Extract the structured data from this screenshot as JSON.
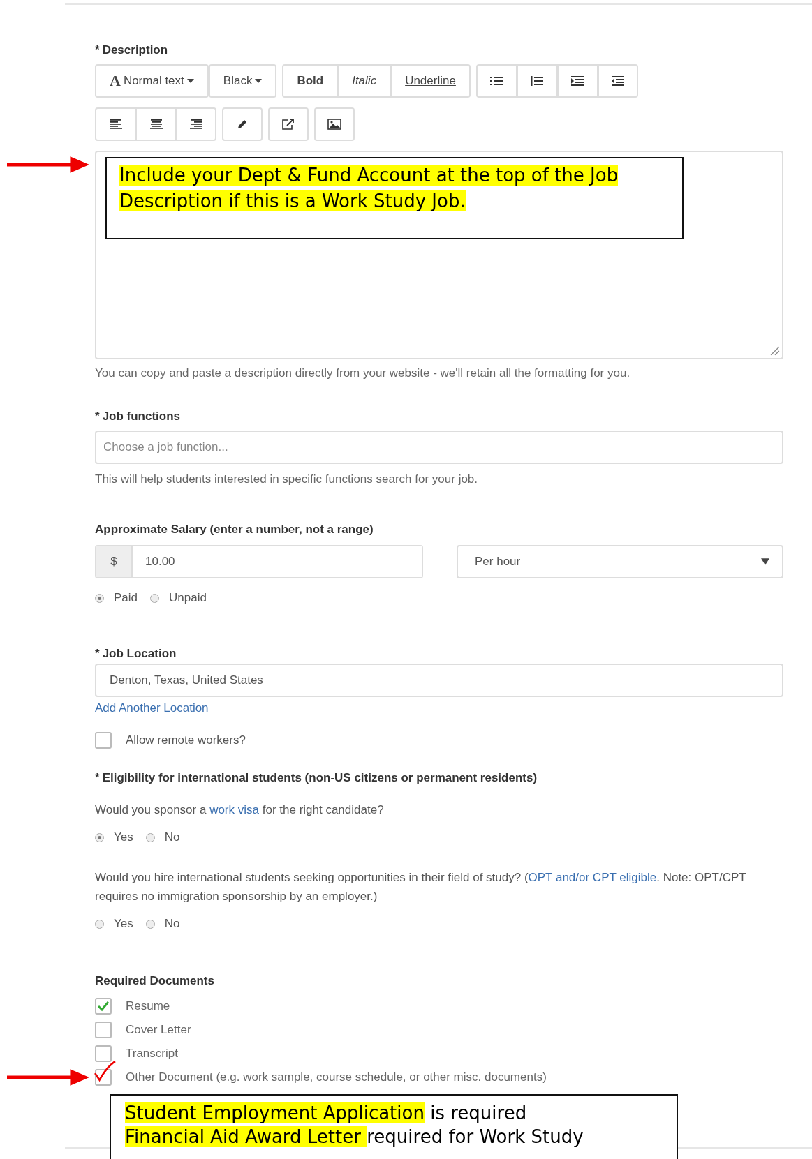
{
  "description": {
    "label": "Description",
    "marker": "*",
    "toolbar": [
      {
        "label": "Normal text",
        "prefix": "A",
        "kind": "dropdown"
      },
      {
        "label": "Black",
        "kind": "dropdown"
      },
      {
        "label": "Bold",
        "kind": "bold"
      },
      {
        "label": "Italic",
        "kind": "italic"
      },
      {
        "label": "Underline",
        "kind": "underline"
      }
    ],
    "note": "Include your Dept & Fund Account at the top of the Job Description if this is a Work Study Job.",
    "help": "You can copy and paste a description directly from your website - we'll retain all the formatting for you."
  },
  "job_functions": {
    "label": "Job functions",
    "marker": "*",
    "placeholder": "Choose a job function...",
    "help": "This will help students interested in specific functions search for your job."
  },
  "salary": {
    "label": "Approximate Salary (enter a number, not a range)",
    "currency": "$",
    "value": "10.00",
    "period": "Per hour",
    "options": [
      {
        "label": "Paid",
        "selected": true
      },
      {
        "label": "Unpaid",
        "selected": false
      }
    ]
  },
  "location": {
    "label": "Job Location",
    "marker": "*",
    "value": "Denton, Texas, United States",
    "link": "Add Another Location",
    "remote": {
      "label": "Allow remote workers?",
      "checked": false
    }
  },
  "eligibility": {
    "label": "Eligibility for international students (non-US citizens or permanent residents)",
    "marker": "*",
    "questions": [
      {
        "text": [
          {
            "text": "Would you sponsor a ",
            "kind": "text"
          },
          {
            "text": "work visa",
            "kind": "link"
          },
          {
            "text": " for the right candidate?",
            "kind": "text"
          }
        ],
        "options": [
          {
            "label": "Yes",
            "selected": true
          },
          {
            "label": "No",
            "selected": false
          }
        ]
      },
      {
        "text": [
          {
            "text": "Would you hire international students seeking opportunities in their field of study? (",
            "kind": "text"
          },
          {
            "text": "OPT and/or CPT eligible",
            "kind": "link"
          },
          {
            "text": ". Note: OPT/CPT requires no immigration sponsorship by an employer.)",
            "kind": "text"
          }
        ],
        "options": [
          {
            "label": "Yes",
            "selected": false
          },
          {
            "label": "No",
            "selected": false
          }
        ]
      }
    ]
  },
  "documents": {
    "label": "Required Documents",
    "items": [
      {
        "label": "Resume",
        "checked": true,
        "kind": "standard"
      },
      {
        "label": "Cover Letter",
        "checked": false,
        "kind": "standard"
      },
      {
        "label": "Transcript",
        "checked": false,
        "kind": "standard"
      },
      {
        "label": "Other Document (e.g. work sample, course schedule, or other misc. documents)",
        "checked": true,
        "kind": "hand-ticked"
      }
    ],
    "note": [
      [
        {
          "text": "Student Employment Application",
          "highlight": true
        },
        {
          "text": " is required",
          "highlight": false
        }
      ],
      [
        {
          "text": "Financial Aid Award Letter ",
          "highlight": true
        },
        {
          "text": "required for Work Study",
          "highlight": false
        }
      ]
    ]
  }
}
